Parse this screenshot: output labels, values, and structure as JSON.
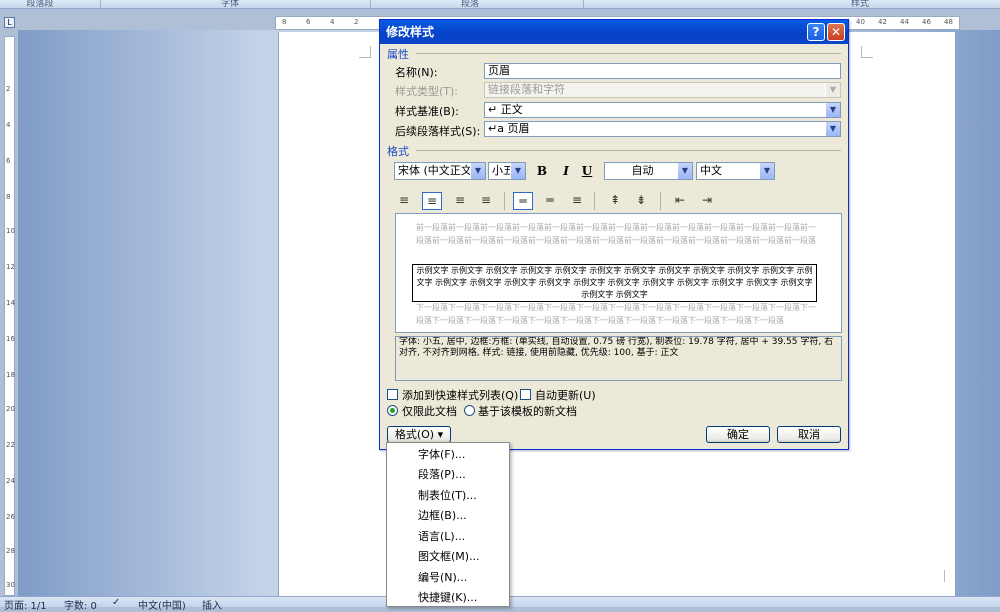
{
  "ribbon": {
    "groups": [
      "段落段",
      "字体",
      "段落",
      "样式"
    ]
  },
  "ruler": {
    "button": "L",
    "h_ticks": [
      "8",
      "6",
      "4",
      "2",
      "40",
      "42",
      "44",
      "46",
      "48"
    ],
    "v_ticks": [
      "2",
      "4",
      "6",
      "8",
      "10",
      "12",
      "14",
      "16",
      "18",
      "20",
      "22",
      "24",
      "26",
      "28",
      "30"
    ]
  },
  "status": {
    "page": "页面: 1/1",
    "words": "字数: 0",
    "language": "中文(中国)",
    "mode": "插入"
  },
  "dialog": {
    "title": "修改样式",
    "help_btn": "?",
    "close_btn": "✕",
    "properties_header": "属性",
    "name_label": "名称(N):",
    "name_value": "页眉",
    "type_label": "样式类型(T):",
    "type_value": "链接段落和字符",
    "based_label": "样式基准(B):",
    "based_value": "↵ 正文",
    "next_label": "后续段落样式(S):",
    "next_value": "↵a 页眉",
    "format_header": "格式",
    "font": "宋体 (中文正文",
    "size": "小五",
    "bold": "B",
    "italic": "I",
    "underline": "U",
    "color": "自动",
    "script": "中文",
    "preview_prev": "前一段落前一段落前一段落前一段落前一段落前一段落前一段落前一段落前一段落前一段落前一段落前一段落前一段落前一段落前一段落前一段落前一段落前一段落前一段落前一段落前一段落前一段落前一段落前一段落前一段落",
    "preview_sample": "示例文字 示例文字 示例文字 示例文字 示例文字 示例文字 示例文字 示例文字 示例文字 示例文字 示例文字 示例文字 示例文字 示例文字 示例文字 示例文字 示例文字 示例文字 示例文字 示例文字 示例文字 示例文字 示例文字 示例文字 示例文字",
    "preview_next": "下一段落下一段落下一段落下一段落下一段落下一段落下一段落下一段落下一段落下一段落下一段落下一段落下一段落下一段落下一段落下一段落下一段落下一段落下一段落下一段落下一段落下一段落下一段落下一段落",
    "description": "字体: 小五, 居中, 边框:方框: (单实线, 自动设置, 0.75 磅 行宽), 制表位: 19.78 字符, 居中 + 39.55 字符, 右对齐, 不对齐到网格, 样式: 链接, 使用前隐藏, 优先级: 100, 基于: 正文",
    "quick_list": "添加到快速样式列表(Q)",
    "auto_update": "自动更新(U)",
    "only_doc": "仅限此文档",
    "new_docs": "基于该模板的新文档",
    "format_button": "格式(O) ▾",
    "ok": "确定",
    "cancel": "取消"
  },
  "format_menu": [
    "字体(F)...",
    "段落(P)...",
    "制表位(T)...",
    "边框(B)...",
    "语言(L)...",
    "图文框(M)...",
    "编号(N)...",
    "快捷键(K)..."
  ]
}
